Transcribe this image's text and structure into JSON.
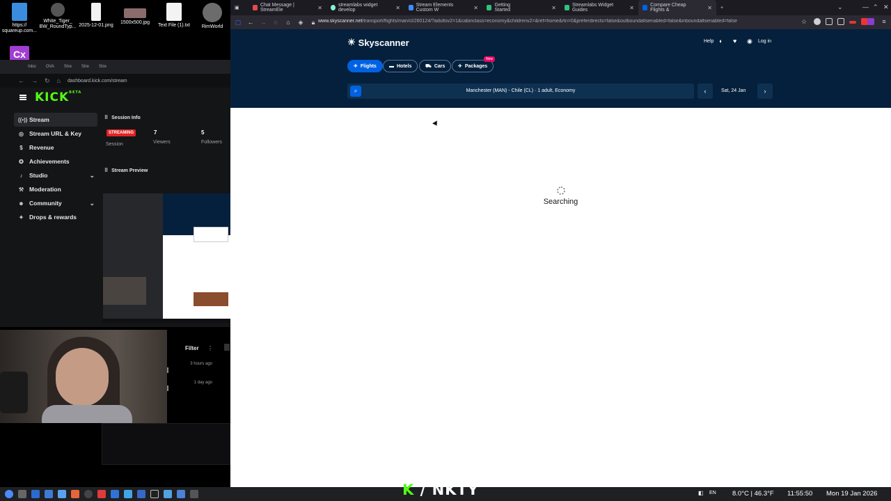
{
  "desktop": {
    "icons": [
      {
        "label": "https://\nsquareup.com...",
        "icon": "url-file-icon"
      },
      {
        "label": "White_Tiger_\nBW_RoundTyp...",
        "icon": "tiger-image-icon"
      },
      {
        "label": "2025-12-01.png",
        "icon": "image-file-icon"
      },
      {
        "label": "1500x500.jpg",
        "icon": "image-file-icon"
      },
      {
        "label": "Text File (1).txt",
        "icon": "text-file-icon"
      },
      {
        "label": "RimWorld",
        "icon": "rimworld-icon"
      }
    ],
    "cx_label": "Cx"
  },
  "kick": {
    "tabs": [
      "Inbo",
      "OVA",
      "Stre",
      "Stre",
      "Stre"
    ],
    "url": "dashboard.kick.com/stream",
    "logo": "KICK",
    "logo_sup": "BETA",
    "nav": [
      {
        "label": "Stream",
        "icon": "stream-icon",
        "active": true
      },
      {
        "label": "Stream URL & Key",
        "icon": "globe-icon"
      },
      {
        "label": "Revenue",
        "icon": "dollar-icon"
      },
      {
        "label": "Achievements",
        "icon": "star-icon"
      },
      {
        "label": "Studio",
        "icon": "mic-icon",
        "chevron": true
      },
      {
        "label": "Moderation",
        "icon": "hammer-icon"
      },
      {
        "label": "Community",
        "icon": "community-icon",
        "chevron": true
      },
      {
        "label": "Drops & rewards",
        "icon": "gift-icon"
      }
    ],
    "session": {
      "title": "Session Info",
      "status": "STREAMING",
      "session_label": "Session",
      "viewers": "7",
      "viewers_label": "Viewers",
      "followers": "5",
      "followers_label": "Followers"
    },
    "preview_title": "Stream Preview",
    "chat": {
      "filter_label": "Filter",
      "times": [
        "3 hours ago",
        "1 day ago"
      ]
    }
  },
  "browser": {
    "tabs": [
      {
        "title": "Chat Message | StreamEle",
        "color": "#e14b4b"
      },
      {
        "title": "streamlabs widget develop",
        "color": "#80f5d2"
      },
      {
        "title": "Stream Elements Custom W",
        "color": "#3c8dff"
      },
      {
        "title": "Getting Started",
        "color": "#31c27c"
      },
      {
        "title": "Streamlabs Widget Guides",
        "color": "#31c27c"
      },
      {
        "title": "Compare Cheap Flights & ",
        "color": "#0062e3",
        "active": true
      }
    ],
    "url_domain": "www.skyscanner.net",
    "url_path": "/transport/flights/man/cl/260124/?adultsv2=1&cabinclass=economy&childrenv2=&ref=home&rtn=0&preferdirects=false&outboundaltsenabled=false&inboundaltsenabled=false"
  },
  "skyscanner": {
    "logo": "Skyscanner",
    "help": "Help",
    "login": "Log in",
    "tabs": [
      {
        "label": "Flights",
        "icon": "plane-icon",
        "active": true
      },
      {
        "label": "Hotels",
        "icon": "bed-icon"
      },
      {
        "label": "Cars",
        "icon": "car-icon"
      },
      {
        "label": "Packages",
        "icon": "package-icon"
      }
    ],
    "new_badge": "New",
    "route": "Manchester (MAN) - Chile (CL)  ·  1 adult, Economy",
    "date": "Sat, 24 Jan",
    "status": "Searching"
  },
  "taskbar": {
    "lang": "EN",
    "weather": "8.0°C | 46.3°F",
    "time": "11:55:50",
    "date": "Mon 19 Jan 2026"
  },
  "overlay": {
    "k": "K",
    "slash": "/",
    "name": "NKTY"
  }
}
